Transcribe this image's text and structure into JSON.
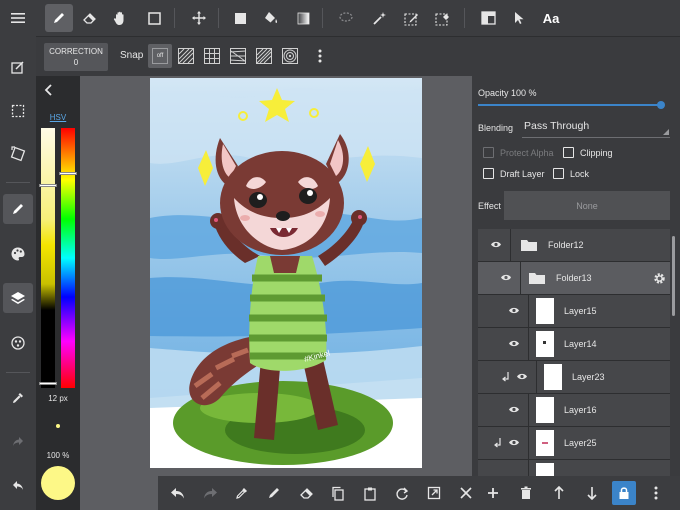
{
  "toolbar": {
    "menu_icon": "hamburger-icon",
    "tools": [
      "pen-icon",
      "eraser-icon",
      "hand-icon",
      "select-rect-icon",
      "move-icon",
      "fill-rect-icon",
      "bucket-icon",
      "gradient-icon",
      "lasso-icon",
      "magic-wand-icon",
      "select-pen-icon",
      "select-eraser-icon",
      "layout-icon",
      "pointer-icon"
    ],
    "text_tool_label": "Aa"
  },
  "subbar": {
    "correction_label": "CORRECTION",
    "correction_value": "0",
    "snap_label": "Snap",
    "snap_off_label": "off"
  },
  "colors": {
    "accent": "#3b84c9",
    "hsv_link": "#5aa7e6",
    "current_color": "#fdf887"
  },
  "color_panel": {
    "mode_label": "HSV",
    "brush_size": "12 px",
    "brush_opacity": "100 %"
  },
  "right_panel": {
    "opacity_label": "Opacity 100 %",
    "opacity_value": 1.0,
    "blending_label": "Blending",
    "blending_value": "Pass Through",
    "protect_alpha_label": "Protect Alpha",
    "clipping_label": "Clipping",
    "draft_layer_label": "Draft Layer",
    "lock_label": "Lock",
    "effect_label": "Effect",
    "effect_value": "None"
  },
  "layers": [
    {
      "name": "Folder12",
      "type": "folder"
    },
    {
      "name": "Folder13",
      "type": "folder"
    },
    {
      "name": "Layer15",
      "type": "layer"
    },
    {
      "name": "Layer14",
      "type": "layer"
    },
    {
      "name": "Layer23",
      "type": "layer"
    },
    {
      "name": "Layer16",
      "type": "layer"
    },
    {
      "name": "Layer25",
      "type": "layer"
    },
    {
      "name": "",
      "type": "layer"
    }
  ],
  "canvas": {
    "signature_text": "#Kinkel"
  }
}
